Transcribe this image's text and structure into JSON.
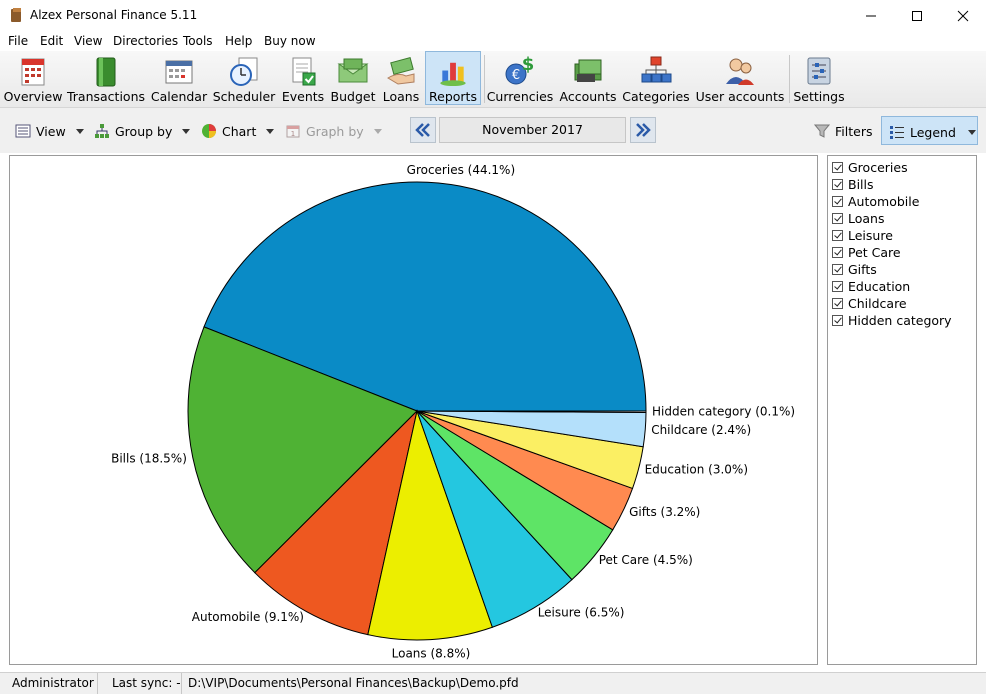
{
  "window": {
    "title": "Alzex Personal Finance 5.11"
  },
  "menu": [
    "File",
    "Edit",
    "View",
    "Directories",
    "Tools",
    "Help",
    "Buy now"
  ],
  "toolbar": {
    "overview": "Overview",
    "transactions": "Transactions",
    "calendar": "Calendar",
    "scheduler": "Scheduler",
    "events": "Events",
    "budget": "Budget",
    "loans": "Loans",
    "reports": "Reports",
    "currencies": "Currencies",
    "accounts": "Accounts",
    "categories": "Categories",
    "user_accounts": "User accounts",
    "settings": "Settings"
  },
  "subbar": {
    "view": "View",
    "group_by": "Group by",
    "chart": "Chart",
    "graph_by": "Graph by",
    "period": "November 2017",
    "filters": "Filters",
    "legend": "Legend"
  },
  "legend_items": [
    "Groceries",
    "Bills",
    "Automobile",
    "Loans",
    "Leisure",
    "Pet Care",
    "Gifts",
    "Education",
    "Childcare",
    "Hidden category"
  ],
  "chart_data": {
    "type": "pie",
    "slices": [
      {
        "label": "Groceries (44.1%)",
        "value": 44.1,
        "color": "#0a8bc6"
      },
      {
        "label": "Bills (18.5%)",
        "value": 18.5,
        "color": "#4fb234"
      },
      {
        "label": "Automobile (9.1%)",
        "value": 9.1,
        "color": "#ee5820"
      },
      {
        "label": "Loans (8.8%)",
        "value": 8.8,
        "color": "#ecee00"
      },
      {
        "label": "Leisure (6.5%)",
        "value": 6.5,
        "color": "#24c7e0"
      },
      {
        "label": "Pet Care (4.5%)",
        "value": 4.5,
        "color": "#5ee466"
      },
      {
        "label": "Gifts (3.2%)",
        "value": 3.2,
        "color": "#ff8a50"
      },
      {
        "label": "Education (3.0%)",
        "value": 3.0,
        "color": "#fbef63"
      },
      {
        "label": "Childcare (2.4%)",
        "value": 2.4,
        "color": "#b4e0fb"
      },
      {
        "label": "Hidden category (0.1%)",
        "value": 0.1,
        "color": "#ececec"
      }
    ]
  },
  "status": {
    "user": "Administrator",
    "last_sync": "Last sync: -",
    "path": "D:\\VIP\\Documents\\Personal Finances\\Backup\\Demo.pfd"
  }
}
